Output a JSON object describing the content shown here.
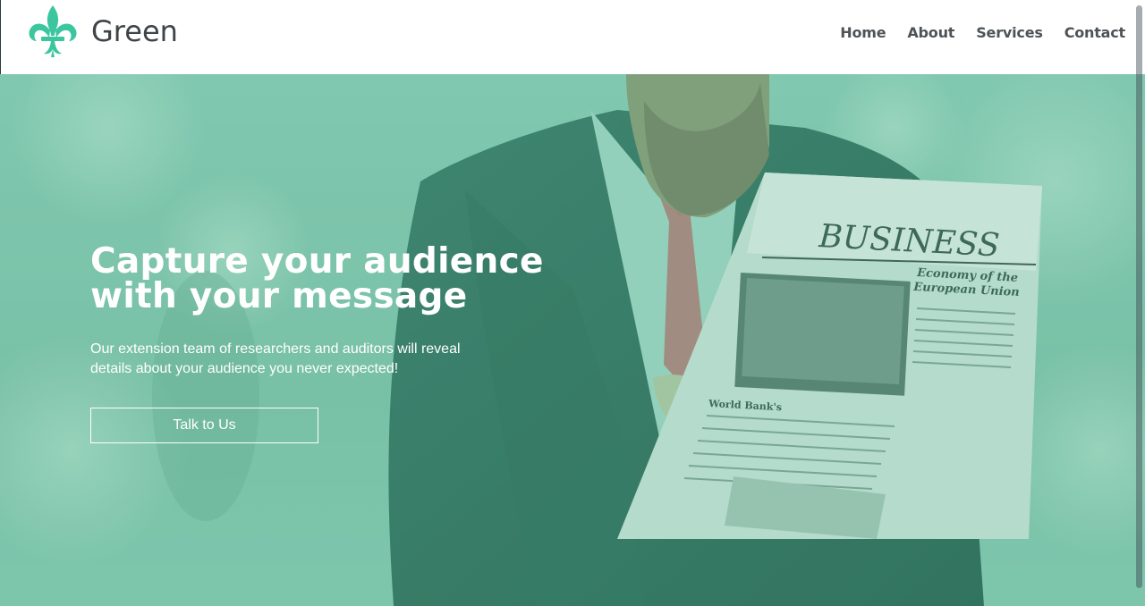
{
  "brand": {
    "name": "Green",
    "logo_icon": "fleur-de-lis-icon",
    "accent": "#3cc6a0"
  },
  "nav": {
    "items": [
      {
        "label": "Home"
      },
      {
        "label": "About"
      },
      {
        "label": "Services"
      },
      {
        "label": "Contact"
      }
    ]
  },
  "hero": {
    "title": "Capture your audience\nwith your message",
    "subtitle": "Our extension team of researchers and auditors will reveal\ndetails about your audience you never expected!",
    "cta_label": "Talk to Us",
    "newspaper": {
      "masthead": "BUSINESS",
      "headline": "Economy of the\nEuropean Union",
      "subheadline": "World Bank's"
    },
    "overlay_color": "#7fc6ad"
  }
}
